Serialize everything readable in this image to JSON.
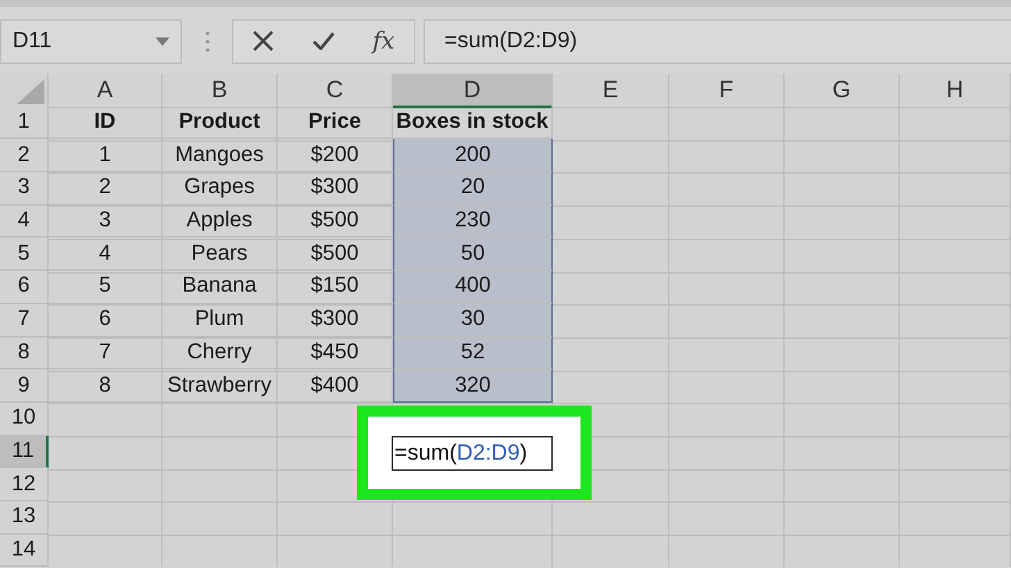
{
  "name_box": {
    "value": "D11"
  },
  "formula_bar": {
    "function_label": "fx",
    "value": "=sum(D2:D9)"
  },
  "columns": [
    {
      "label": "A",
      "selected": false
    },
    {
      "label": "B",
      "selected": false
    },
    {
      "label": "C",
      "selected": false
    },
    {
      "label": "D",
      "selected": true
    },
    {
      "label": "E",
      "selected": false
    },
    {
      "label": "F",
      "selected": false
    },
    {
      "label": "G",
      "selected": false
    },
    {
      "label": "H",
      "selected": false
    }
  ],
  "rows": [
    {
      "number": "1",
      "selected": false,
      "kind": "header",
      "cells": [
        {
          "text": "ID",
          "selected": false
        },
        {
          "text": "Product",
          "selected": false
        },
        {
          "text": "Price",
          "selected": false
        },
        {
          "text": "Boxes in stock",
          "selected": false
        }
      ]
    },
    {
      "number": "2",
      "selected": false,
      "kind": "data",
      "cells": [
        {
          "text": "1",
          "selected": false
        },
        {
          "text": "Mangoes",
          "selected": false
        },
        {
          "text": "$200",
          "selected": false
        },
        {
          "text": "200",
          "selected": true
        }
      ]
    },
    {
      "number": "3",
      "selected": false,
      "kind": "data",
      "cells": [
        {
          "text": "2",
          "selected": false
        },
        {
          "text": "Grapes",
          "selected": false
        },
        {
          "text": "$300",
          "selected": false
        },
        {
          "text": "20",
          "selected": true
        }
      ]
    },
    {
      "number": "4",
      "selected": false,
      "kind": "data",
      "cells": [
        {
          "text": "3",
          "selected": false
        },
        {
          "text": "Apples",
          "selected": false
        },
        {
          "text": "$500",
          "selected": false
        },
        {
          "text": "230",
          "selected": true
        }
      ]
    },
    {
      "number": "5",
      "selected": false,
      "kind": "data",
      "cells": [
        {
          "text": "4",
          "selected": false
        },
        {
          "text": "Pears",
          "selected": false
        },
        {
          "text": "$500",
          "selected": false
        },
        {
          "text": "50",
          "selected": true
        }
      ]
    },
    {
      "number": "6",
      "selected": false,
      "kind": "data",
      "cells": [
        {
          "text": "5",
          "selected": false
        },
        {
          "text": "Banana",
          "selected": false
        },
        {
          "text": "$150",
          "selected": false
        },
        {
          "text": "400",
          "selected": true
        }
      ]
    },
    {
      "number": "7",
      "selected": false,
      "kind": "data",
      "cells": [
        {
          "text": "6",
          "selected": false
        },
        {
          "text": "Plum",
          "selected": false
        },
        {
          "text": "$300",
          "selected": false
        },
        {
          "text": "30",
          "selected": true
        }
      ]
    },
    {
      "number": "8",
      "selected": false,
      "kind": "data",
      "cells": [
        {
          "text": "7",
          "selected": false
        },
        {
          "text": "Cherry",
          "selected": false
        },
        {
          "text": "$450",
          "selected": false
        },
        {
          "text": "52",
          "selected": true
        }
      ]
    },
    {
      "number": "9",
      "selected": false,
      "kind": "data",
      "cells": [
        {
          "text": "8",
          "selected": false
        },
        {
          "text": "Strawberry",
          "selected": false
        },
        {
          "text": "$400",
          "selected": false
        },
        {
          "text": "320",
          "selected": true
        }
      ]
    },
    {
      "number": "10",
      "selected": false,
      "kind": "empty"
    },
    {
      "number": "11",
      "selected": true,
      "kind": "empty"
    },
    {
      "number": "12",
      "selected": false,
      "kind": "empty"
    },
    {
      "number": "13",
      "selected": false,
      "kind": "empty"
    },
    {
      "number": "14",
      "selected": false,
      "kind": "empty"
    }
  ],
  "active_cell": {
    "prefix": "=sum(",
    "reference": "D2:D9",
    "suffix": ")",
    "highlighted": true
  }
}
